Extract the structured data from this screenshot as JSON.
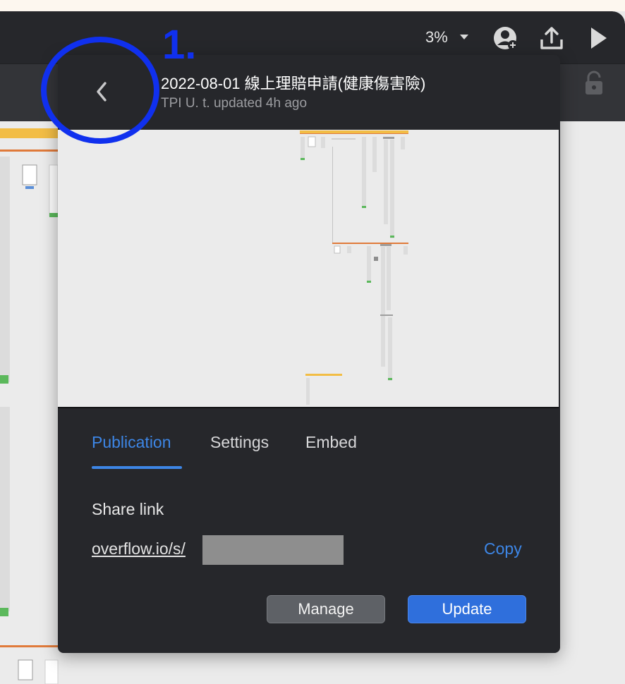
{
  "toolbar": {
    "zoom": "3%",
    "icons": [
      "user-add-icon",
      "upload-icon",
      "play-icon"
    ]
  },
  "popover": {
    "title": "2022-08-01 線上理賠申請(健康傷害險)",
    "subtitle": "TPI U. t. updated 4h ago",
    "tabs": [
      {
        "label": "Publication",
        "active": true
      },
      {
        "label": "Settings",
        "active": false
      },
      {
        "label": "Embed",
        "active": false
      }
    ],
    "share_label": "Share link",
    "share_link": "overflow.io/s/",
    "copy_label": "Copy",
    "manage_label": "Manage",
    "update_label": "Update"
  },
  "annotation": {
    "number": "1.",
    "color": "#1030ee"
  },
  "colors": {
    "accent": "#3d86e6",
    "panel": "#26272b",
    "update_button": "#2f6fdc"
  }
}
